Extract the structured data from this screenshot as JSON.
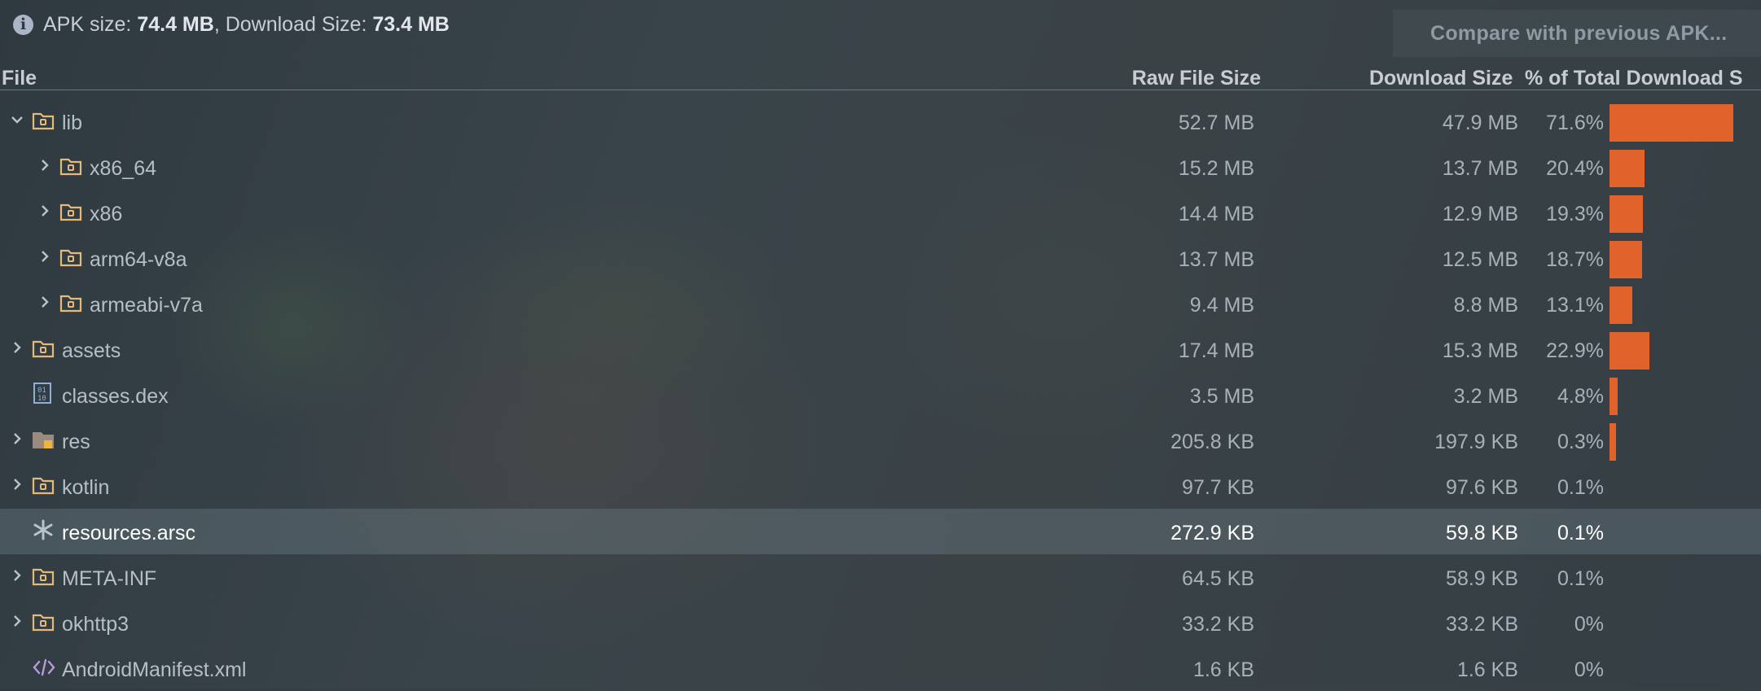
{
  "summary": {
    "apk_label": "APK size: ",
    "apk_value": "74.4 MB",
    "sep": ", Download Size: ",
    "download_value": "73.4 MB"
  },
  "compare_button": "Compare with previous APK...",
  "columns": {
    "file": "File",
    "raw": "Raw File Size",
    "download": "Download Size",
    "percent": "% of Total Download S"
  },
  "colors": {
    "bar": "#e2622c",
    "folder": "#e5b97a",
    "dex": "#8fb0d4",
    "xml": "#b79ae0"
  },
  "rows": [
    {
      "name": "lib",
      "raw": "52.7 MB",
      "dl": "47.9 MB",
      "pct": "71.6%",
      "fraction": 0.716,
      "level": 0,
      "expander": "expanded",
      "icon": "folder"
    },
    {
      "name": "x86_64",
      "raw": "15.2 MB",
      "dl": "13.7 MB",
      "pct": "20.4%",
      "fraction": 0.204,
      "level": 1,
      "expander": "collapsed",
      "icon": "folder"
    },
    {
      "name": "x86",
      "raw": "14.4 MB",
      "dl": "12.9 MB",
      "pct": "19.3%",
      "fraction": 0.193,
      "level": 1,
      "expander": "collapsed",
      "icon": "folder"
    },
    {
      "name": "arm64-v8a",
      "raw": "13.7 MB",
      "dl": "12.5 MB",
      "pct": "18.7%",
      "fraction": 0.187,
      "level": 1,
      "expander": "collapsed",
      "icon": "folder"
    },
    {
      "name": "armeabi-v7a",
      "raw": "9.4 MB",
      "dl": "8.8 MB",
      "pct": "13.1%",
      "fraction": 0.131,
      "level": 1,
      "expander": "collapsed",
      "icon": "folder"
    },
    {
      "name": "assets",
      "raw": "17.4 MB",
      "dl": "15.3 MB",
      "pct": "22.9%",
      "fraction": 0.229,
      "level": 0,
      "expander": "collapsed",
      "icon": "folder"
    },
    {
      "name": "classes.dex",
      "raw": "3.5 MB",
      "dl": "3.2 MB",
      "pct": "4.8%",
      "fraction": 0.048,
      "level": 0,
      "expander": "none",
      "icon": "dex"
    },
    {
      "name": "res",
      "raw": "205.8 KB",
      "dl": "197.9 KB",
      "pct": "0.3%",
      "fraction": 0.003,
      "level": 0,
      "expander": "collapsed",
      "icon": "res-folder"
    },
    {
      "name": "kotlin",
      "raw": "97.7 KB",
      "dl": "97.6 KB",
      "pct": "0.1%",
      "fraction": 0.001,
      "level": 0,
      "expander": "collapsed",
      "icon": "folder"
    },
    {
      "name": "resources.arsc",
      "raw": "272.9 KB",
      "dl": "59.8 KB",
      "pct": "0.1%",
      "fraction": 0.001,
      "level": 0,
      "expander": "none",
      "icon": "asterisk",
      "selected": true
    },
    {
      "name": "META-INF",
      "raw": "64.5 KB",
      "dl": "58.9 KB",
      "pct": "0.1%",
      "fraction": 0.001,
      "level": 0,
      "expander": "collapsed",
      "icon": "folder"
    },
    {
      "name": "okhttp3",
      "raw": "33.2 KB",
      "dl": "33.2 KB",
      "pct": "0%",
      "fraction": 0.0,
      "level": 0,
      "expander": "collapsed",
      "icon": "folder"
    },
    {
      "name": "AndroidManifest.xml",
      "raw": "1.6 KB",
      "dl": "1.6 KB",
      "pct": "0%",
      "fraction": 0.0,
      "level": 0,
      "expander": "none",
      "icon": "xml"
    }
  ]
}
